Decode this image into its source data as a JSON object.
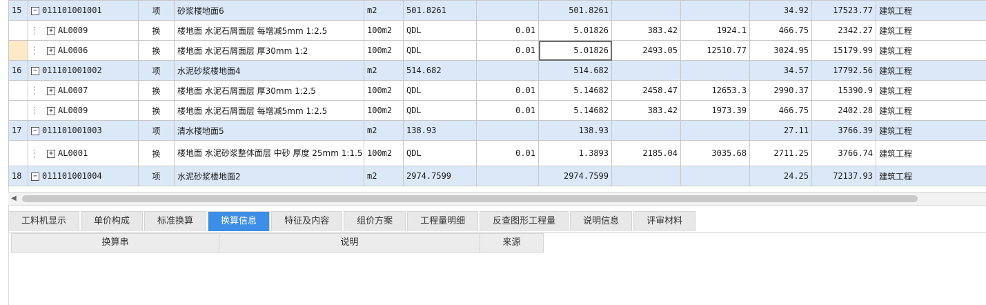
{
  "rows": [
    {
      "type": "item",
      "idx": "15",
      "code": "011101001001",
      "unit_type": "项",
      "name": "砂浆楼地面6",
      "unit": "m2",
      "expr": "501.8261",
      "coef": "",
      "qty": "501.8261",
      "price": "",
      "amount": "",
      "unit_price": "34.92",
      "total": "17523.77",
      "category": "建筑工程"
    },
    {
      "type": "sub",
      "idx": "",
      "code": "AL0009",
      "unit_type": "换",
      "name": "楼地面 水泥石屑面层 每增减5mm 1:2.5",
      "unit": "100m2",
      "expr": "QDL",
      "coef": "0.01",
      "qty": "5.01826",
      "price": "383.42",
      "amount": "1924.1",
      "unit_price": "466.75",
      "total": "2342.27",
      "category": "建筑工程"
    },
    {
      "type": "sub",
      "idx": "",
      "code": "AL0006",
      "unit_type": "换",
      "name": "楼地面 水泥石屑面层 厚30mm 1:2",
      "unit": "100m2",
      "expr": "QDL",
      "coef": "0.01",
      "qty": "5.01826",
      "price": "2493.05",
      "amount": "12510.77",
      "unit_price": "3024.95",
      "total": "15179.99",
      "category": "建筑工程"
    },
    {
      "type": "item",
      "idx": "16",
      "code": "011101001002",
      "unit_type": "项",
      "name": "水泥砂浆楼地面4",
      "unit": "m2",
      "expr": "514.682",
      "coef": "",
      "qty": "514.682",
      "price": "",
      "amount": "",
      "unit_price": "34.57",
      "total": "17792.56",
      "category": "建筑工程"
    },
    {
      "type": "sub",
      "idx": "",
      "code": "AL0007",
      "unit_type": "换",
      "name": "楼地面 水泥石屑面层 厚30mm 1:2.5",
      "unit": "100m2",
      "expr": "QDL",
      "coef": "0.01",
      "qty": "5.14682",
      "price": "2458.47",
      "amount": "12653.3",
      "unit_price": "2990.37",
      "total": "15390.9",
      "category": "建筑工程"
    },
    {
      "type": "sub",
      "idx": "",
      "code": "AL0009",
      "unit_type": "换",
      "name": "楼地面 水泥石屑面层 每增减5mm 1:2.5",
      "unit": "100m2",
      "expr": "QDL",
      "coef": "0.01",
      "qty": "5.14682",
      "price": "383.42",
      "amount": "1973.39",
      "unit_price": "466.75",
      "total": "2402.28",
      "category": "建筑工程"
    },
    {
      "type": "item",
      "idx": "17",
      "code": "011101001003",
      "unit_type": "项",
      "name": "清水楼地面5",
      "unit": "m2",
      "expr": "138.93",
      "coef": "",
      "qty": "138.93",
      "price": "",
      "amount": "",
      "unit_price": "27.11",
      "total": "3766.39",
      "category": "建筑工程"
    },
    {
      "type": "sub",
      "idx": "",
      "code": "AL0001",
      "unit_type": "换",
      "name": "楼地面 水泥砂浆整体面层 中砂 厚度 25mm 1:1.5",
      "unit": "100m2",
      "expr": "QDL",
      "coef": "0.01",
      "qty": "1.3893",
      "price": "2185.04",
      "amount": "3035.68",
      "unit_price": "2711.25",
      "total": "3766.74",
      "category": "建筑工程"
    },
    {
      "type": "item",
      "idx": "18",
      "code": "011101001004",
      "unit_type": "项",
      "name": "水泥砂浆楼地面2",
      "unit": "m2",
      "expr": "2974.7599",
      "coef": "",
      "qty": "2974.7599",
      "price": "",
      "amount": "",
      "unit_price": "24.25",
      "total": "72137.93",
      "category": "建筑工程"
    }
  ],
  "tabs": [
    "工料机显示",
    "单价构成",
    "标准换算",
    "换算信息",
    "特征及内容",
    "组价方案",
    "工程量明细",
    "反查图形工程量",
    "说明信息",
    "评审材料"
  ],
  "active_tab": "换算信息",
  "detail_headers": [
    "换算串",
    "说明",
    "来源"
  ],
  "icons": {
    "expanded": "minus-box",
    "collapsed": "plus-box",
    "scroll_left": "triangle-left"
  },
  "colors": {
    "item_row": "#dbe8f8",
    "active_tab": "#3d8ee6",
    "selected_index": "#fde8c8"
  }
}
